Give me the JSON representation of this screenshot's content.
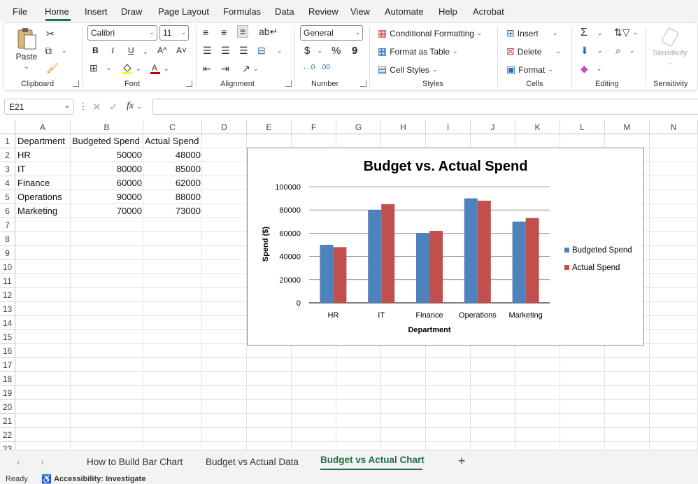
{
  "menu": {
    "items": [
      "File",
      "Home",
      "Insert",
      "Draw",
      "Page Layout",
      "Formulas",
      "Data",
      "Review",
      "View",
      "Automate",
      "Help",
      "Acrobat"
    ],
    "active": "Home"
  },
  "ribbon": {
    "clipboard": {
      "paste_label": "Paste",
      "group_label": "Clipboard"
    },
    "font": {
      "font_name": "Calibri",
      "font_size": "11",
      "bold": "B",
      "italic": "I",
      "underline": "U",
      "grow": "A^",
      "shrink": "A˅",
      "group_label": "Font"
    },
    "alignment": {
      "group_label": "Alignment"
    },
    "number": {
      "format": "General",
      "currency": "$",
      "percent": "%",
      "comma": "9",
      "group_label": "Number"
    },
    "styles": {
      "conditional": "Conditional Formatting",
      "format_table": "Format as Table",
      "cell_styles": "Cell Styles",
      "group_label": "Styles"
    },
    "cells": {
      "insert": "Insert",
      "delete": "Delete",
      "format": "Format",
      "group_label": "Cells"
    },
    "editing": {
      "group_label": "Editing"
    },
    "sensitivity": {
      "button_label": "Sensitivity",
      "group_label": "Sensitivity"
    }
  },
  "formula_bar": {
    "name_box": "E21",
    "fx": "fx",
    "value": ""
  },
  "columns": [
    "A",
    "B",
    "C",
    "D",
    "E",
    "F",
    "G",
    "H",
    "I",
    "J",
    "K",
    "L",
    "M",
    "N"
  ],
  "rows": [
    "1",
    "2",
    "3",
    "4",
    "5",
    "6",
    "7",
    "8",
    "9",
    "10",
    "11",
    "12",
    "13",
    "14",
    "15",
    "16",
    "17",
    "18",
    "19",
    "20",
    "21",
    "22",
    "23"
  ],
  "cells": {
    "headers": [
      "Department",
      "Budgeted Spend",
      "Actual Spend"
    ],
    "data": [
      [
        "HR",
        "50000",
        "48000"
      ],
      [
        "IT",
        "80000",
        "85000"
      ],
      [
        "Finance",
        "60000",
        "62000"
      ],
      [
        "Operations",
        "90000",
        "88000"
      ],
      [
        "Marketing",
        "70000",
        "73000"
      ]
    ]
  },
  "chart_data": {
    "type": "bar",
    "title": "Budget vs. Actual Spend",
    "xlabel": "Department",
    "ylabel": "Spend ($)",
    "categories": [
      "HR",
      "IT",
      "Finance",
      "Operations",
      "Marketing"
    ],
    "series": [
      {
        "name": "Budgeted Spend",
        "values": [
          50000,
          80000,
          60000,
          90000,
          70000
        ],
        "color": "#4f81bd"
      },
      {
        "name": "Actual Spend",
        "values": [
          48000,
          85000,
          62000,
          88000,
          73000
        ],
        "color": "#c0504d"
      }
    ],
    "ylim": [
      0,
      100000
    ],
    "yticks": [
      "0",
      "20000",
      "40000",
      "60000",
      "80000",
      "100000"
    ],
    "grid": true,
    "legend_position": "right"
  },
  "sheet_tabs": {
    "items": [
      "How to Build Bar Chart",
      "Budget vs Actual Data",
      "Budget vs Actual Chart"
    ],
    "active": "Budget vs Actual Chart",
    "add": "+"
  },
  "status_bar": {
    "ready": "Ready",
    "accessibility": "Accessibility: Investigate"
  }
}
